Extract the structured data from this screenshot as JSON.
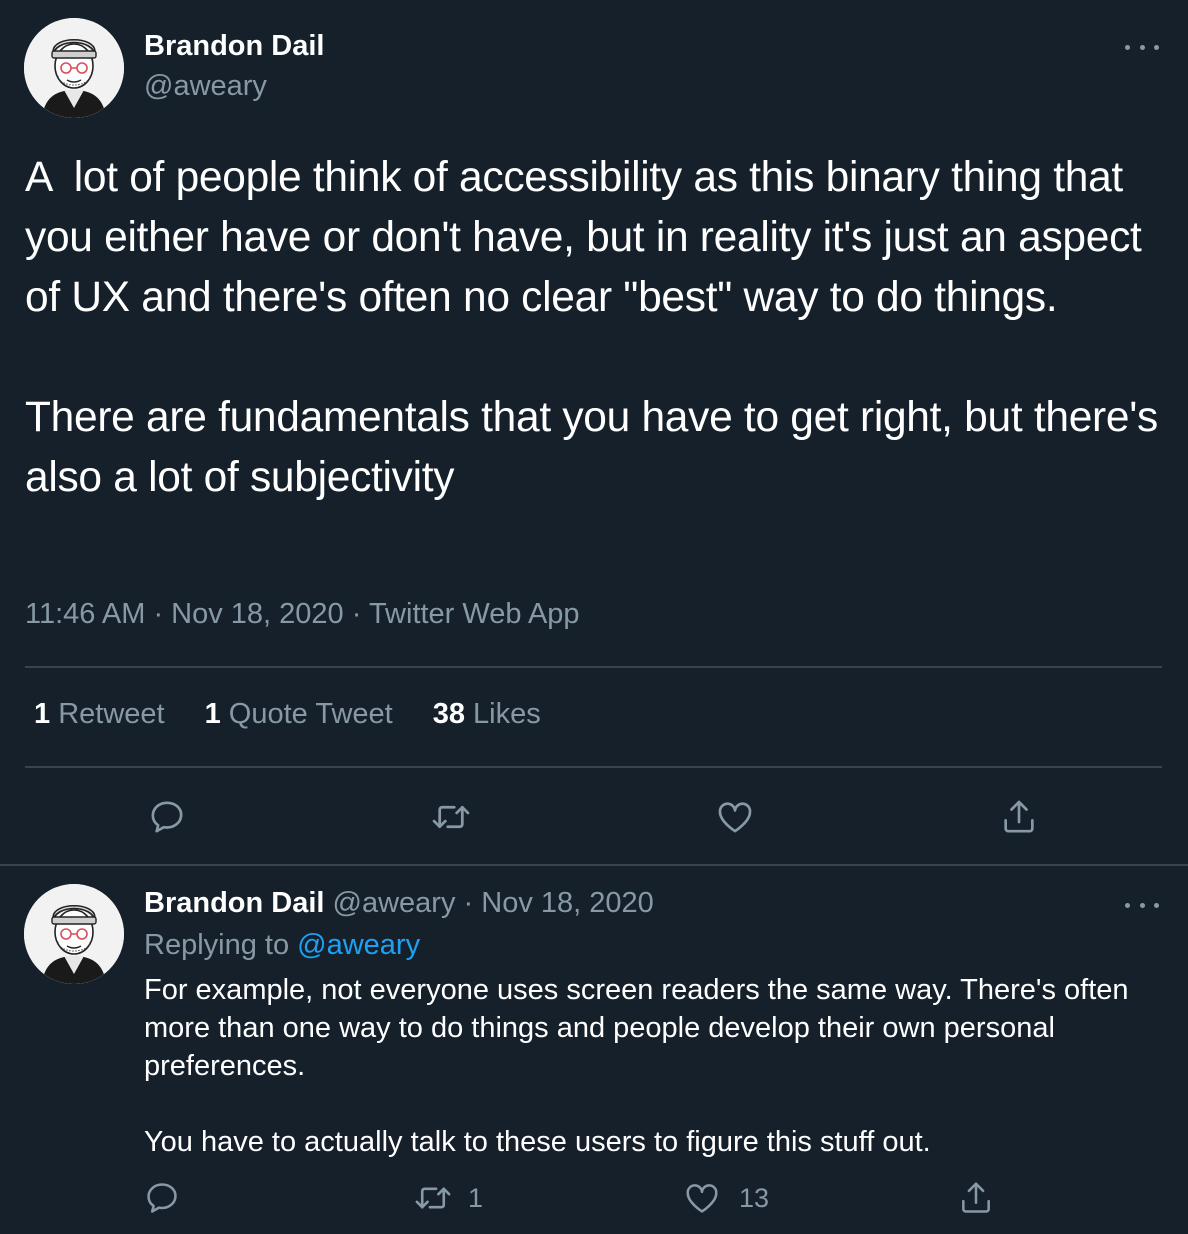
{
  "tweet": {
    "author_name": "Brandon Dail",
    "author_handle": "@aweary",
    "paragraphs": [
      "A  lot of people think of accessibility as this binary thing that you either have or don't have, but in reality it's just an aspect of UX and there's often no clear \"best\" way to do things.",
      "There are fundamentals that you have to get right, but there's also a lot of subjectivity"
    ],
    "time": "11:46 AM",
    "date": "Nov 18, 2020",
    "source": "Twitter Web App",
    "separator": " · ",
    "stats": {
      "retweets_count": "1",
      "retweets_label": " Retweet",
      "quotes_count": "1",
      "quotes_label": " Quote Tweet",
      "likes_count": "38",
      "likes_label": " Likes"
    }
  },
  "reply": {
    "author_name": "Brandon Dail",
    "author_handle": "@aweary",
    "separator": " · ",
    "date": "Nov 18, 2020",
    "replying_to_label": "Replying to ",
    "replying_to_handle": "@aweary",
    "paragraphs": [
      "For example, not everyone uses screen readers the same way. There's often more than one way to do things and people develop their own personal preferences.",
      "You have to actually talk to these users to figure this stuff out."
    ],
    "retweet_count": "1",
    "like_count": "13"
  },
  "icons": {
    "reply": "reply-icon",
    "retweet": "retweet-icon",
    "like": "heart-icon",
    "share": "share-icon",
    "more": "more-icon"
  },
  "colors": {
    "background": "#15202b",
    "divider": "#38444d",
    "secondary_text": "#8899a6",
    "link": "#1da1f2"
  }
}
